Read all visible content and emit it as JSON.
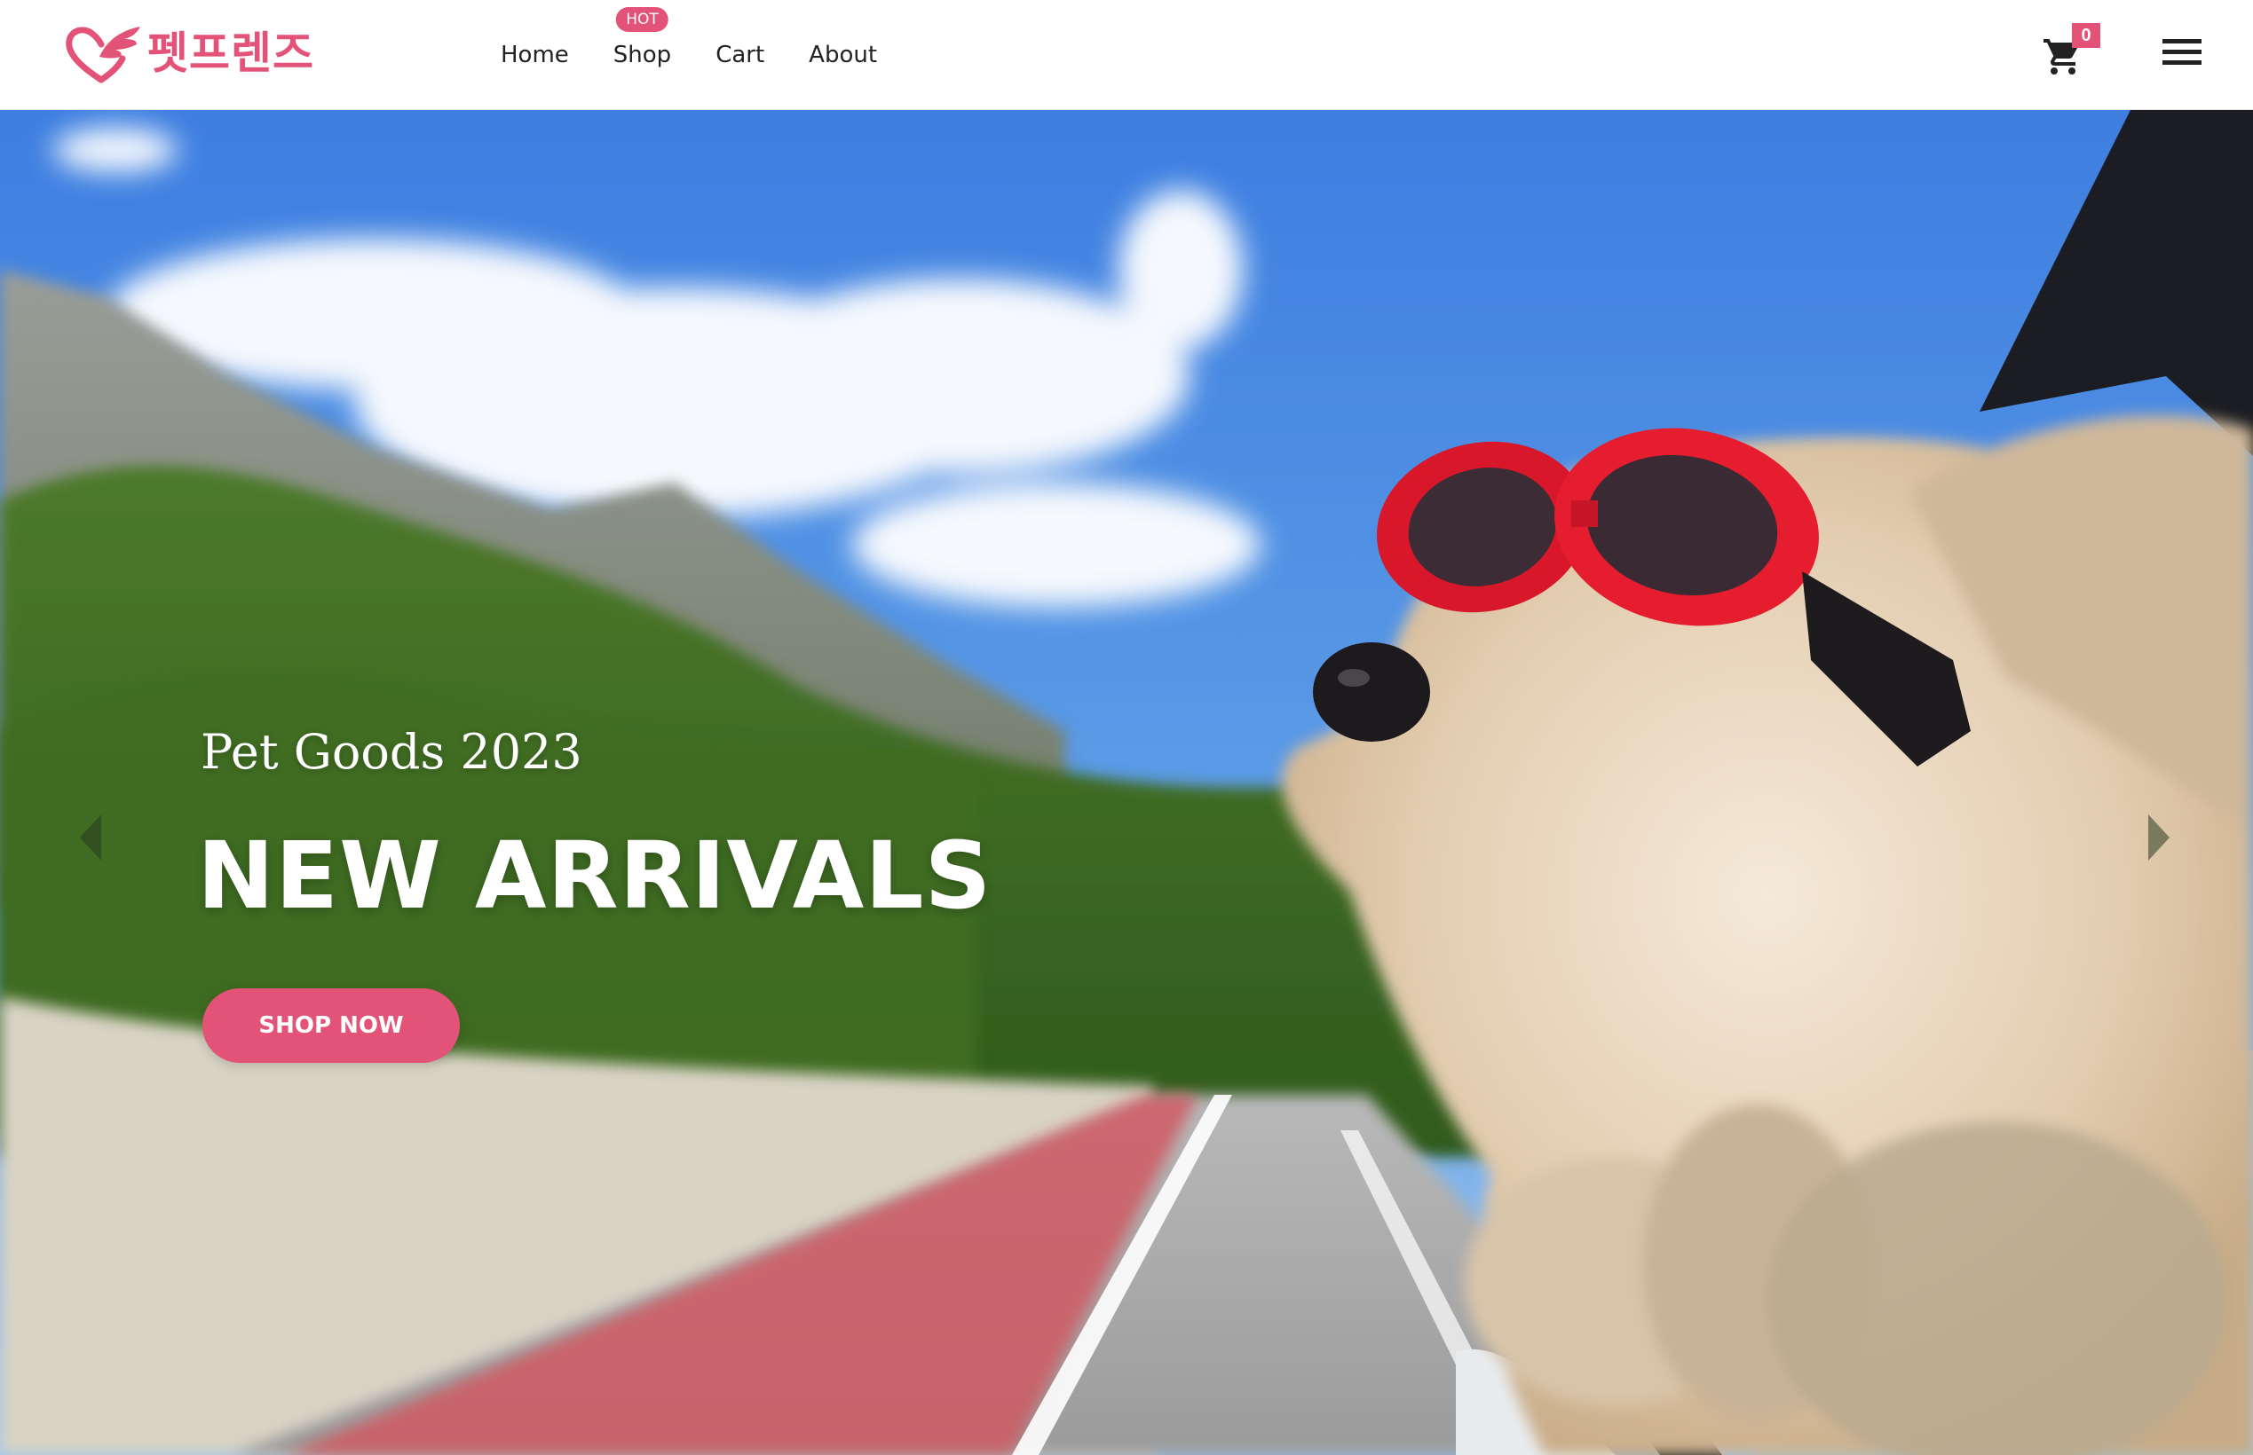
{
  "brand": {
    "logo_text": "펫프렌즈",
    "accent_color": "#e35277"
  },
  "nav": {
    "items": [
      {
        "label": "Home"
      },
      {
        "label": "Shop",
        "badge": "HOT"
      },
      {
        "label": "Cart"
      },
      {
        "label": "About"
      }
    ]
  },
  "cart": {
    "icon": "cart-icon",
    "count": "0"
  },
  "menu": {
    "icon": "hamburger-menu-icon"
  },
  "hero": {
    "subtitle": "Pet Goods 2023",
    "title": "NEW ARRIVALS",
    "cta_label": "SHOP NOW",
    "image_description": "dog-with-red-goggles-in-car-window",
    "prev_icon": "chevron-left-icon",
    "next_icon": "chevron-right-icon"
  }
}
